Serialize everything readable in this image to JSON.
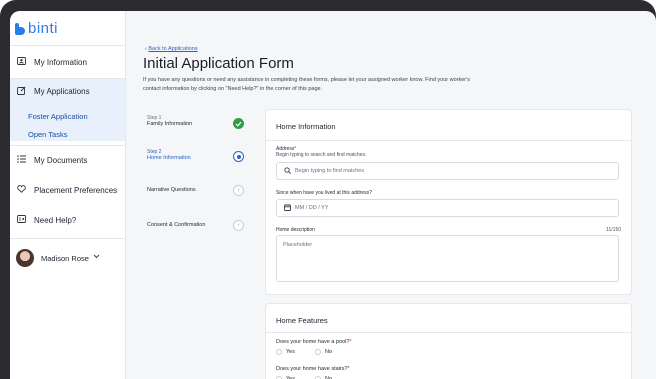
{
  "brand": {
    "name": "binti",
    "color": "#2b7de9"
  },
  "sidebar": {
    "items": [
      {
        "label": "My Information",
        "icon": "person-card-icon"
      },
      {
        "label": "My Applications",
        "icon": "edit-icon"
      },
      {
        "label": "My Documents",
        "icon": "list-icon"
      },
      {
        "label": "Placement Preferences",
        "icon": "heart-icon"
      },
      {
        "label": "Need Help?",
        "icon": "help-card-icon"
      }
    ],
    "sub_items": [
      "Foster Application",
      "Open Tasks"
    ],
    "user": {
      "name": "Madison Rose"
    }
  },
  "main": {
    "back_link": "Back to Applications",
    "title": "Initial Application Form",
    "intro": "If you have any questions or need any assistance in completing these forms, please let your assigned worker know. Find your worker's contact information by clicking on \"Need Help?\" in the corner of this page."
  },
  "steps": [
    {
      "step_label": "Step 1",
      "name": "Family Information",
      "status": "complete"
    },
    {
      "step_label": "Step 2",
      "name": "Home Information",
      "status": "current"
    },
    {
      "step_label": "",
      "name": "Narrative Questions",
      "status": "pending"
    },
    {
      "step_label": "",
      "name": "Consent & Confirmation",
      "status": "pending"
    }
  ],
  "home_information": {
    "title": "Home Information",
    "address_label": "Address",
    "address_required": "*",
    "address_hint": "Begin typing to search and find matches.",
    "address_placeholder": "Begin typing to find matches",
    "since_label": "Since when have you lived at this address?",
    "since_placeholder": "MM / DD / YY",
    "description_label": "Home description",
    "description_counter": "11/150",
    "description_placeholder": "Placeholder"
  },
  "home_features": {
    "title": "Home Features",
    "pool_question": "Does your home have a pool?",
    "stairs_question": "Does your home have stairs?",
    "required": "*",
    "yes_label": "Yes",
    "no_label": "No"
  },
  "colors": {
    "accent": "#2b62c4",
    "success": "#2f9e44",
    "frame": "#2c2c30"
  }
}
